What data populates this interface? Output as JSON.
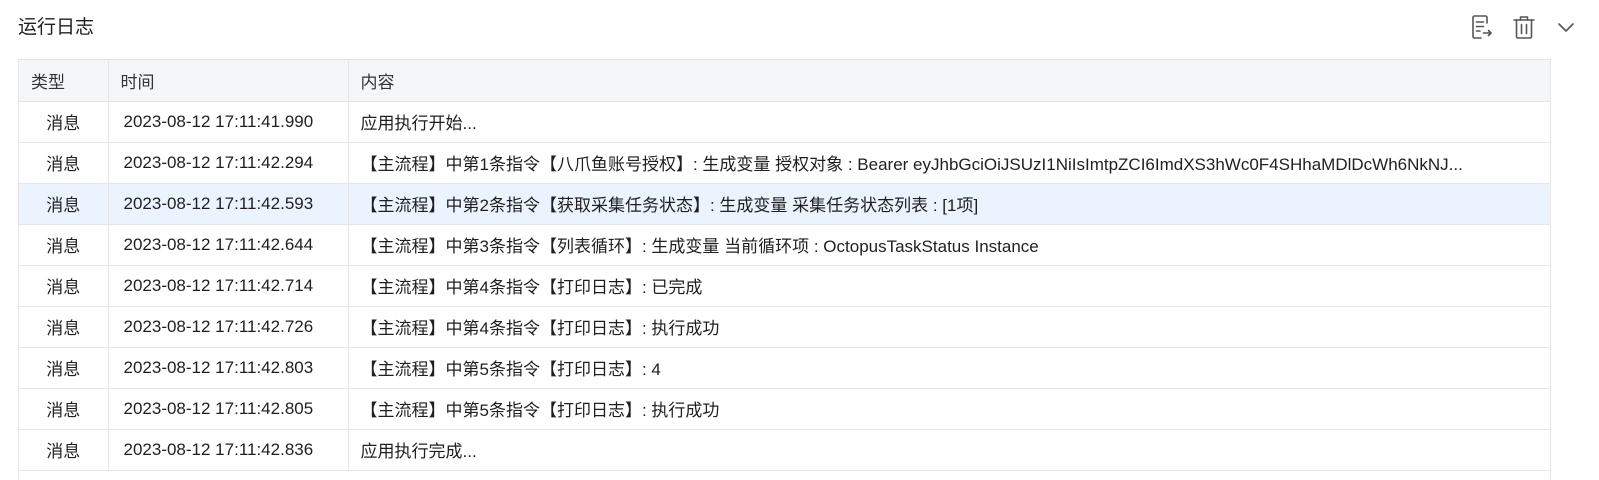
{
  "header": {
    "title": "运行日志"
  },
  "toolbar": {
    "icons": [
      "export-log-icon",
      "trash-icon",
      "chevron-down-icon"
    ]
  },
  "table": {
    "columns": [
      "类型",
      "时间",
      "内容"
    ],
    "highlight_row": 2,
    "highlight_color": "#eaf3fe",
    "rows": [
      {
        "type": "消息",
        "time": "2023-08-12 17:11:41.990",
        "content": "应用执行开始..."
      },
      {
        "type": "消息",
        "time": "2023-08-12 17:11:42.294",
        "content": "【主流程】中第1条指令【八爪鱼账号授权】: 生成变量 授权对象 : Bearer eyJhbGciOiJSUzI1NiIsImtpZCI6ImdXS3hWc0F4SHhaMDlDcWh6NkNJ..."
      },
      {
        "type": "消息",
        "time": "2023-08-12 17:11:42.593",
        "content": "【主流程】中第2条指令【获取采集任务状态】: 生成变量 采集任务状态列表 : [1项]"
      },
      {
        "type": "消息",
        "time": "2023-08-12 17:11:42.644",
        "content": "【主流程】中第3条指令【列表循环】: 生成变量 当前循环项 : OctopusTaskStatus Instance"
      },
      {
        "type": "消息",
        "time": "2023-08-12 17:11:42.714",
        "content": "【主流程】中第4条指令【打印日志】: 已完成"
      },
      {
        "type": "消息",
        "time": "2023-08-12 17:11:42.726",
        "content": "【主流程】中第4条指令【打印日志】: 执行成功"
      },
      {
        "type": "消息",
        "time": "2023-08-12 17:11:42.803",
        "content": "【主流程】中第5条指令【打印日志】: 4"
      },
      {
        "type": "消息",
        "time": "2023-08-12 17:11:42.805",
        "content": "【主流程】中第5条指令【打印日志】: 执行成功"
      },
      {
        "type": "消息",
        "time": "2023-08-12 17:11:42.836",
        "content": "应用执行完成..."
      }
    ]
  }
}
